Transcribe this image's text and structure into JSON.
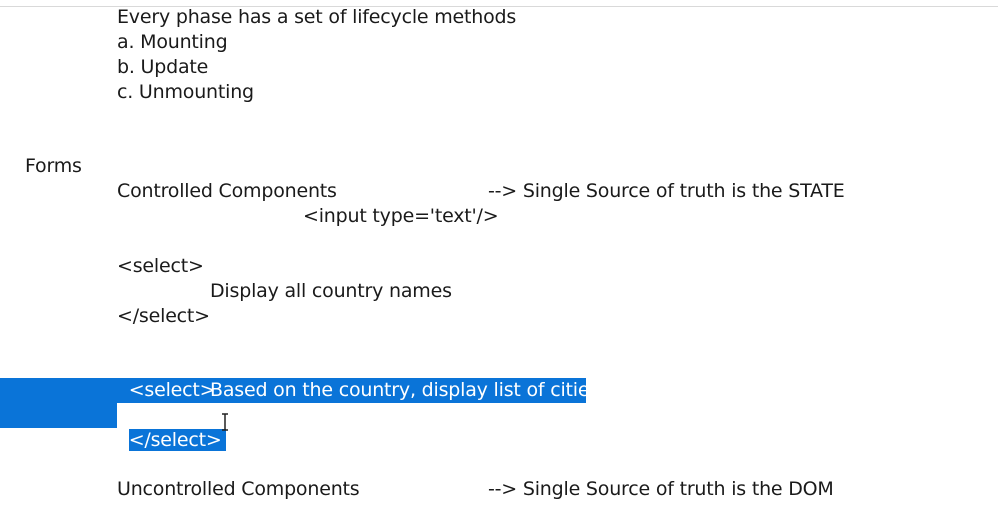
{
  "top_fragment": "~~ ~~~ ~~~",
  "lifecycle": {
    "intro": "Every phase has a set of lifecycle methods",
    "items": [
      "a. Mounting",
      "b. Update",
      "c. Unmounting"
    ]
  },
  "forms": {
    "heading": "Forms",
    "controlled": {
      "label": "Controlled Components",
      "arrow_note": "--> Single Source of truth is the STATE",
      "input_example": "<input type='text'/>"
    },
    "select_block_1": {
      "open": "<select>",
      "body": "Display all country names",
      "close": "</select>"
    },
    "select_block_2": {
      "open": "<select>",
      "body": "Based on the country, display list of cities",
      "close": "</select>"
    },
    "uncontrolled": {
      "label": "Uncontrolled Components",
      "arrow_note": "--> Single Source of truth is the DOM"
    }
  },
  "colors": {
    "selection": "#0a74d8",
    "text": "#1a1a1a"
  },
  "cursor_icon": "text-cursor-icon"
}
